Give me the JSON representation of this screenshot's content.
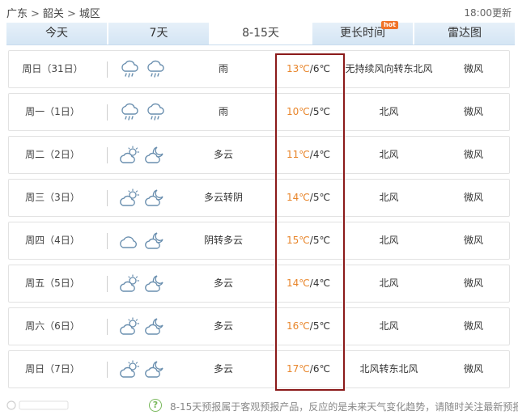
{
  "breadcrumb": [
    "广东",
    "韶关",
    "城区"
  ],
  "breadcrumb_separator": ">",
  "updated": "18:00更新",
  "tabs": [
    {
      "label": "今天",
      "active": false
    },
    {
      "label": "7天",
      "active": false
    },
    {
      "label": "8-15天",
      "active": true
    },
    {
      "label": "更长时间",
      "active": false,
      "badge": "hot"
    },
    {
      "label": "雷达图",
      "active": false
    }
  ],
  "temp_separator": "/",
  "forecast": [
    {
      "date": "周日（31日）",
      "icons": [
        "rain-icon",
        "rain-icon"
      ],
      "condition": "雨",
      "high": "13℃",
      "low": "6℃",
      "wind": "无持续风向转东北风",
      "level": "微风"
    },
    {
      "date": "周一（1日）",
      "icons": [
        "rain-icon",
        "rain-icon"
      ],
      "condition": "雨",
      "high": "10℃",
      "low": "5℃",
      "wind": "北风",
      "level": "微风"
    },
    {
      "date": "周二（2日）",
      "icons": [
        "partly-cloudy-day-icon",
        "partly-cloudy-night-icon"
      ],
      "condition": "多云",
      "high": "11℃",
      "low": "4℃",
      "wind": "北风",
      "level": "微风"
    },
    {
      "date": "周三（3日）",
      "icons": [
        "partly-cloudy-day-icon",
        "partly-cloudy-night-icon"
      ],
      "condition": "多云转阴",
      "high": "14℃",
      "low": "5℃",
      "wind": "北风",
      "level": "微风"
    },
    {
      "date": "周四（4日）",
      "icons": [
        "cloudy-icon",
        "partly-cloudy-night-icon"
      ],
      "condition": "阴转多云",
      "high": "15℃",
      "low": "5℃",
      "wind": "北风",
      "level": "微风"
    },
    {
      "date": "周五（5日）",
      "icons": [
        "partly-cloudy-day-icon",
        "partly-cloudy-night-icon"
      ],
      "condition": "多云",
      "high": "14℃",
      "low": "4℃",
      "wind": "北风",
      "level": "微风"
    },
    {
      "date": "周六（6日）",
      "icons": [
        "partly-cloudy-day-icon",
        "partly-cloudy-night-icon"
      ],
      "condition": "多云",
      "high": "16℃",
      "low": "5℃",
      "wind": "北风",
      "level": "微风"
    },
    {
      "date": "周日（7日）",
      "icons": [
        "partly-cloudy-day-icon",
        "partly-cloudy-night-icon"
      ],
      "condition": "多云",
      "high": "17℃",
      "low": "6℃",
      "wind": "北风转东北风",
      "level": "微风"
    }
  ],
  "footer": {
    "help_icon_text": "?",
    "note": "8-15天预报属于客观预报产品，反应的是未来天气变化趋势，请随时关注最新预报..."
  },
  "colors": {
    "high_temp": "#e8852a",
    "highlight_border": "#8b1a1a",
    "tab_bg": "#dce9f5"
  }
}
